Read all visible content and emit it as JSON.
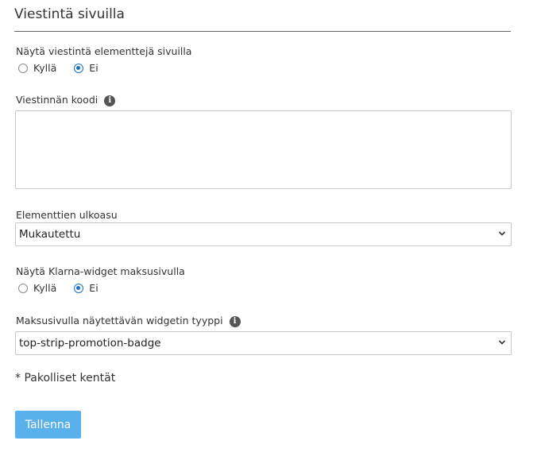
{
  "section": {
    "title": "Viestintä sivuilla"
  },
  "show_messaging": {
    "label": "Näytä viestintä elementtejä sivuilla",
    "options": [
      {
        "label": "Kyllä",
        "selected": false
      },
      {
        "label": "Ei",
        "selected": true
      }
    ]
  },
  "message_code": {
    "label": "Viestinnän koodi",
    "info_icon": "info-icon",
    "value": ""
  },
  "appearance": {
    "label": "Elementtien ulkoasu",
    "value": "Mukautettu"
  },
  "klarna_widget": {
    "label": "Näytä Klarna-widget maksusivulla",
    "options": [
      {
        "label": "Kyllä",
        "selected": false
      },
      {
        "label": "Ei",
        "selected": true
      }
    ]
  },
  "widget_type": {
    "label": "Maksusivulla näytettävän widgetin tyyppi",
    "info_icon": "info-icon",
    "value": "top-strip-promotion-badge"
  },
  "required_note": "* Pakolliset kentät",
  "save_label": "Tallenna",
  "colors": {
    "accent": "#1a6fc9",
    "button": "#58b1ea",
    "border": "#c8c8c8"
  }
}
